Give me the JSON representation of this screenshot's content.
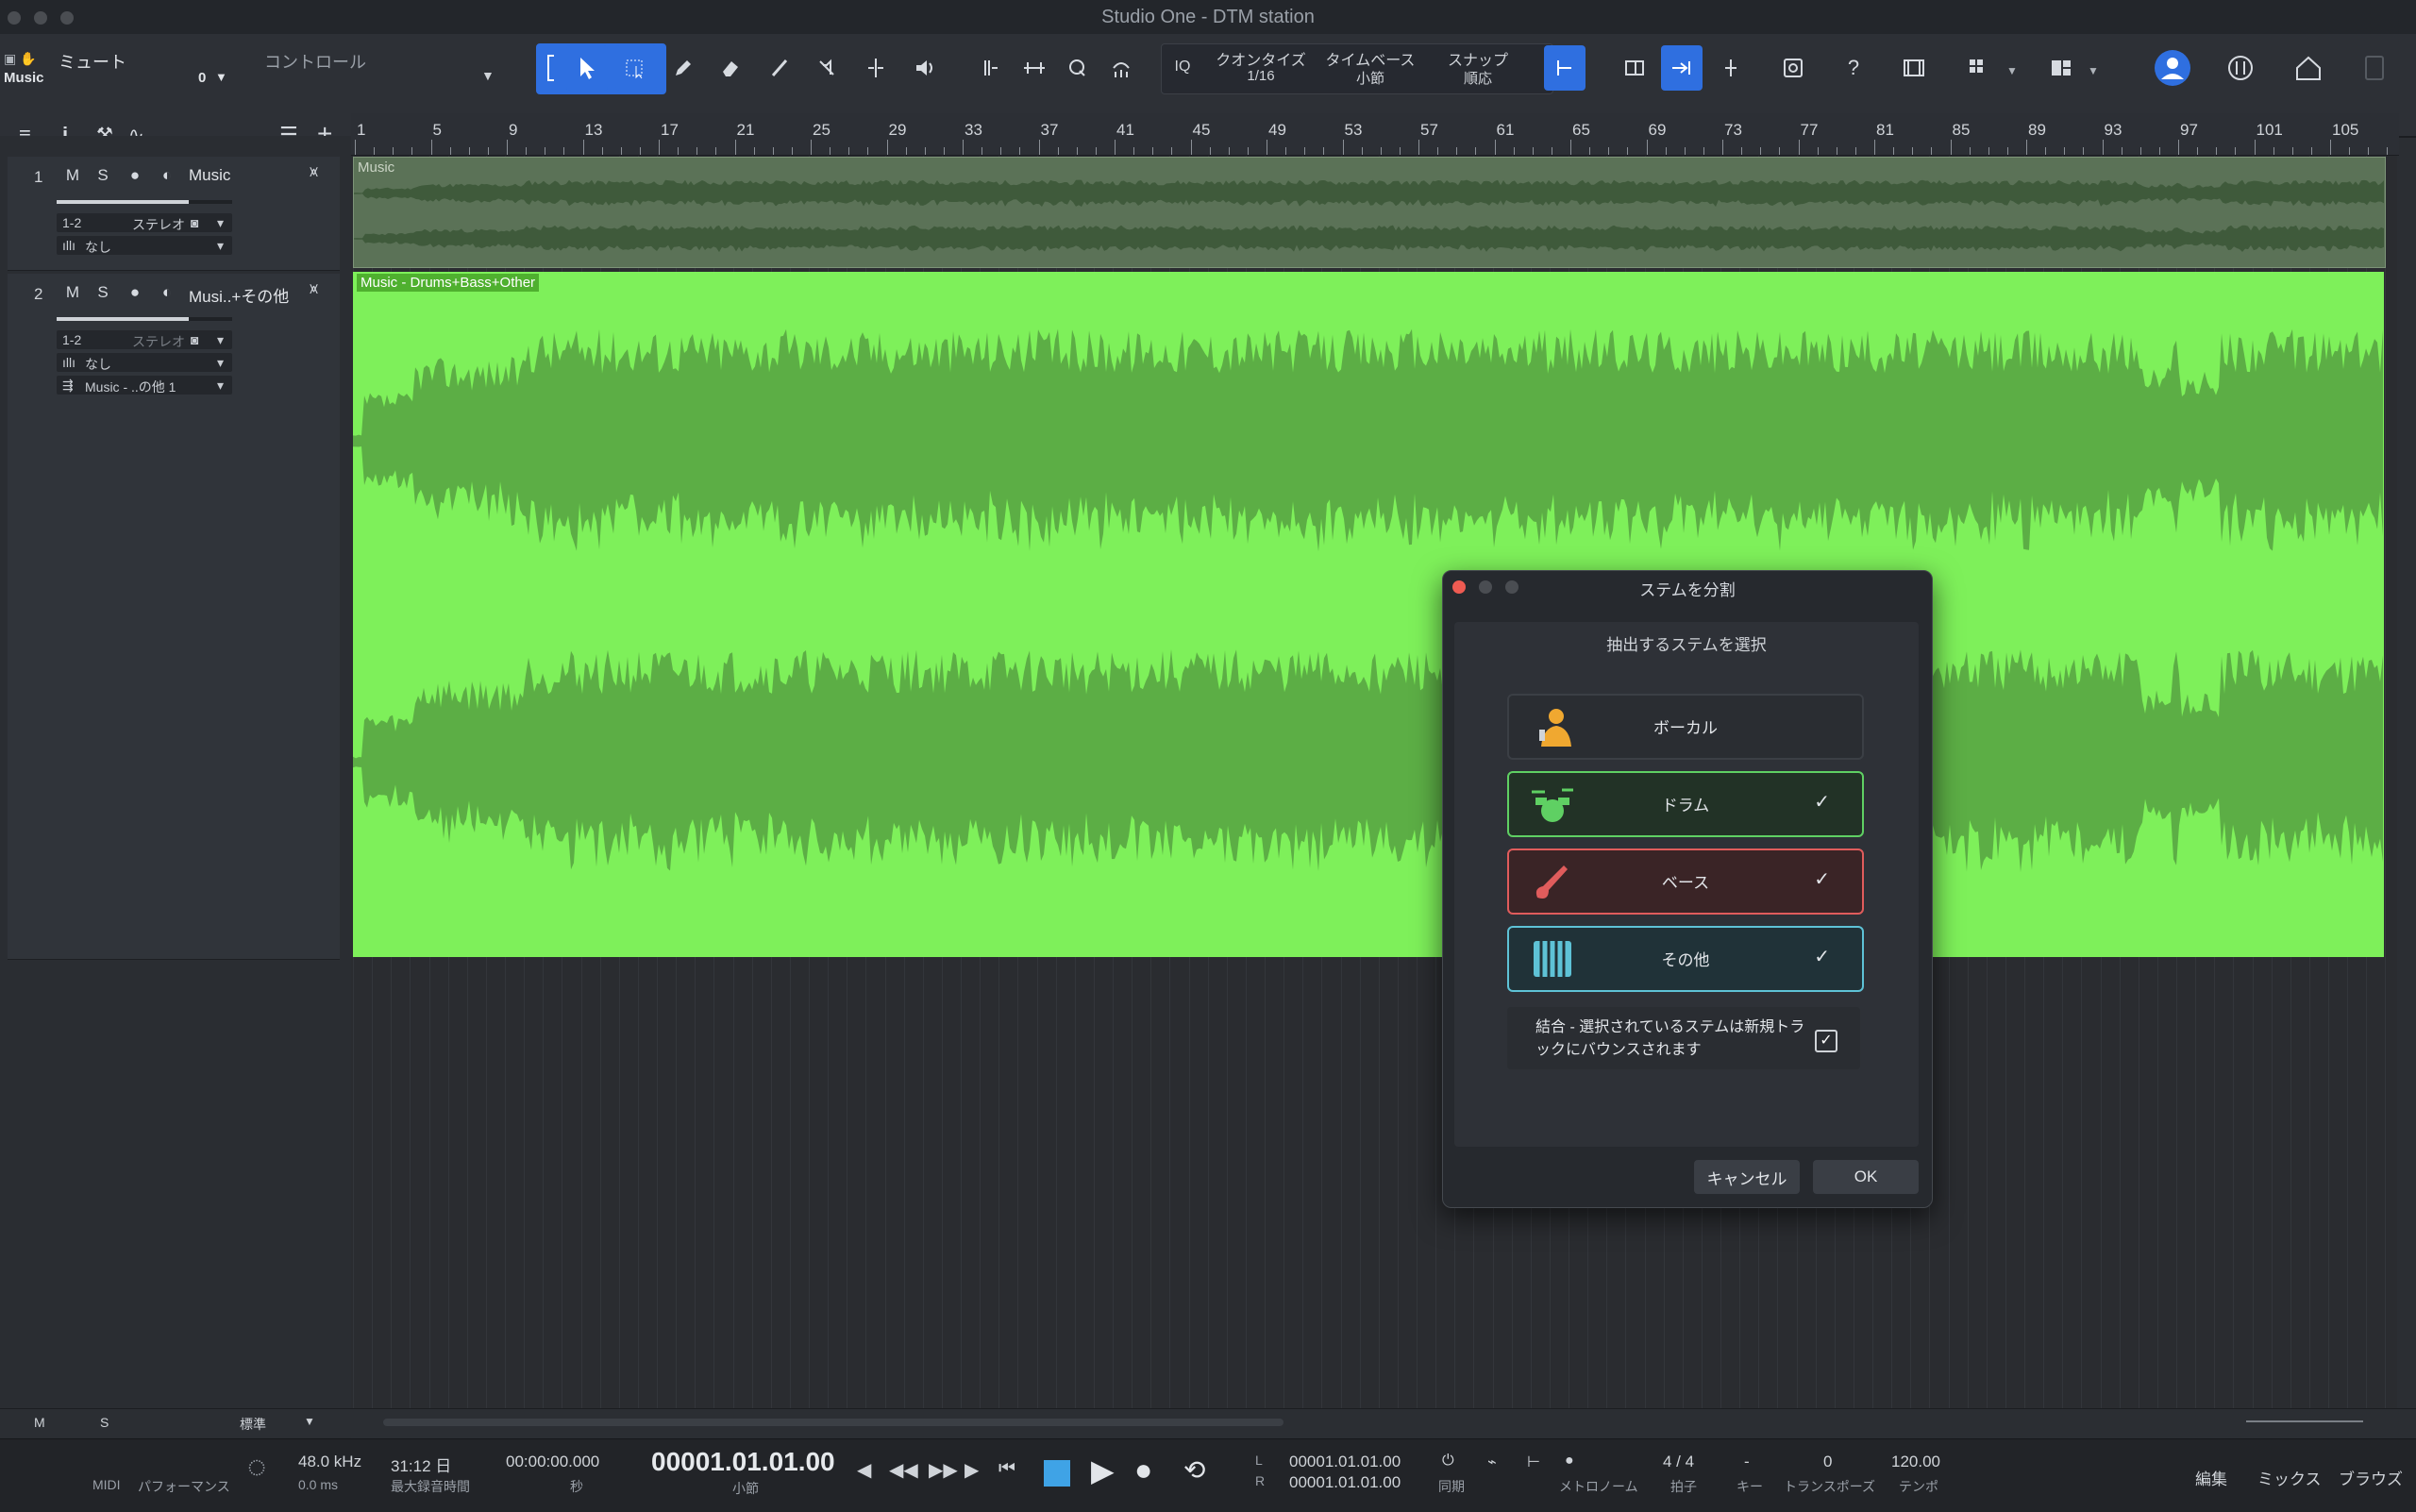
{
  "window": {
    "title": "Studio One - DTM station"
  },
  "toolbar": {
    "mute_label": "ミュート",
    "control_label": "コントロール",
    "track_name": "Music",
    "track_value": "0",
    "iq": "IQ",
    "quantize_label": "クオンタイズ",
    "quantize_value": "1/16",
    "timebase_label": "タイムベース",
    "timebase_value": "小節",
    "snap_label": "スナップ",
    "snap_value": "順応",
    "help": "?"
  },
  "ruler": {
    "labels": [
      "1",
      "5",
      "9",
      "13",
      "17",
      "21",
      "25",
      "29",
      "33",
      "37",
      "41",
      "45",
      "49",
      "53",
      "57",
      "61",
      "65",
      "69",
      "73",
      "77",
      "81",
      "85",
      "89",
      "93",
      "97",
      "101",
      "105"
    ]
  },
  "tracks": [
    {
      "num": "1",
      "m": "M",
      "s": "S",
      "name": "Music",
      "io": "1-2",
      "mode": "ステレオ",
      "send": "なし"
    },
    {
      "num": "2",
      "m": "M",
      "s": "S",
      "name": "Musi..+その他",
      "io": "1-2",
      "mode": "ステレオ",
      "send": "なし",
      "route": "Music - ..の他 1"
    }
  ],
  "clips": {
    "clip1": "Music",
    "clip2": "Music - Drums+Bass+Other"
  },
  "dialog": {
    "title": "ステムを分割",
    "subtitle": "抽出するステムを選択",
    "stems": [
      {
        "label": "ボーカル",
        "checked": ""
      },
      {
        "label": "ドラム",
        "checked": "✓"
      },
      {
        "label": "ベース",
        "checked": "✓"
      },
      {
        "label": "その他",
        "checked": "✓"
      }
    ],
    "combine_text": "結合 - 選択されているステムは新規トラックにバウンスされます",
    "combine_check": "✓",
    "cancel": "キャンセル",
    "ok": "OK"
  },
  "bottom": {
    "m": "M",
    "s": "S",
    "preset": "標準"
  },
  "transport": {
    "midi": "MIDI",
    "performance": "パフォーマンス",
    "sample_rate": "48.0 kHz",
    "latency": "0.0 ms",
    "record_time": "31:12 日",
    "record_time_label": "最大録音時間",
    "seconds": "00:00:00.000",
    "seconds_unit": "秒",
    "position": "00001.01.01.00",
    "position_unit": "小節",
    "l_label": "L",
    "r_label": "R",
    "l_pos": "00001.01.01.00",
    "r_pos": "00001.01.01.00",
    "sync": "同期",
    "metronome": "メトロノーム",
    "timesig": "4 / 4",
    "timesig_label": "拍子",
    "key": "-",
    "key_label": "キー",
    "transpose": "0",
    "transpose_label": "トランスポーズ",
    "tempo": "120.00",
    "tempo_label": "テンポ",
    "edit": "編集",
    "mix": "ミックス",
    "browse": "ブラウズ"
  },
  "colors": {
    "accent": "#2f6fe0",
    "clip_green": "#7ef05a",
    "wave_green": "#5cae45",
    "drum": "#5fd063",
    "bass": "#e05c5c",
    "other": "#5ec2d6"
  }
}
